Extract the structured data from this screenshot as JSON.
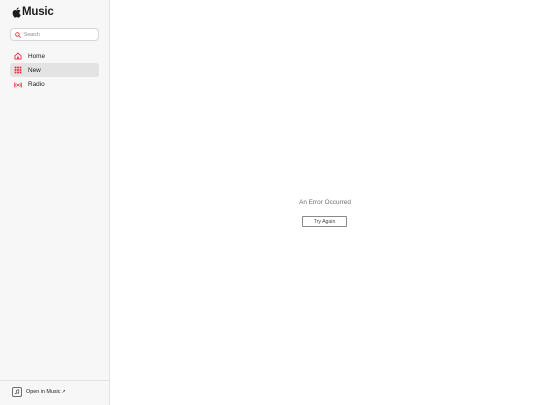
{
  "app": {
    "logo_text": "Music"
  },
  "search": {
    "placeholder": "Search"
  },
  "nav": {
    "items": [
      {
        "label": "Home",
        "icon": "home-icon",
        "active": false
      },
      {
        "label": "New",
        "icon": "grid-icon",
        "active": true
      },
      {
        "label": "Radio",
        "icon": "radio-icon",
        "active": false
      }
    ]
  },
  "footer": {
    "open_label": "Open in Music",
    "arrow": "↗"
  },
  "main": {
    "error_text": "An Error Occurred",
    "retry_label": "Try Again"
  },
  "colors": {
    "accent": "#fa233b",
    "active_bg": "#e3e3e3",
    "sidebar_bg": "#f7f7f7"
  }
}
